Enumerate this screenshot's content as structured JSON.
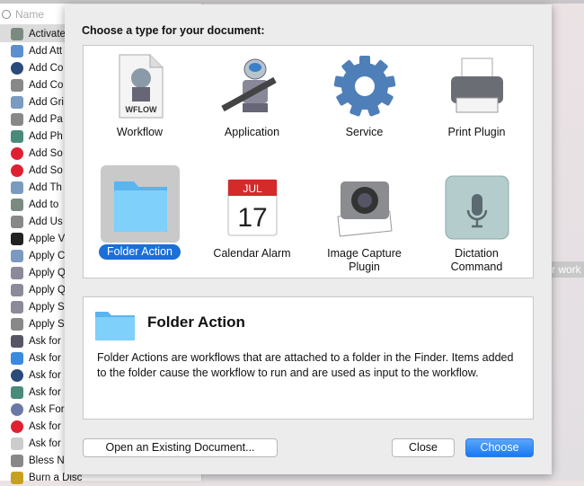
{
  "sidebar": {
    "search_placeholder": "Name",
    "items": [
      {
        "label": "Activate",
        "icon": "font-icon",
        "color": "#7a8a80"
      },
      {
        "label": "Add Att",
        "icon": "mail-icon",
        "color": "#5b8fd0"
      },
      {
        "label": "Add Co",
        "icon": "quicktime-icon",
        "color": "#2a4a7a"
      },
      {
        "label": "Add Co",
        "icon": "automator-icon",
        "color": "#888"
      },
      {
        "label": "Add Gri",
        "icon": "preview-icon",
        "color": "#7a9ac0"
      },
      {
        "label": "Add Pa",
        "icon": "automator-icon",
        "color": "#888"
      },
      {
        "label": "Add Ph",
        "icon": "image-capture-icon",
        "color": "#4a8a7a"
      },
      {
        "label": "Add So",
        "icon": "itunes-icon",
        "color": "#e02030"
      },
      {
        "label": "Add So",
        "icon": "itunes-icon",
        "color": "#e02030"
      },
      {
        "label": "Add Th",
        "icon": "preview-icon",
        "color": "#7a9ac0"
      },
      {
        "label": "Add to",
        "icon": "font-icon",
        "color": "#7a8a80"
      },
      {
        "label": "Add Us",
        "icon": "automator-icon",
        "color": "#888"
      },
      {
        "label": "Apple V",
        "icon": "terminal-icon",
        "color": "#222"
      },
      {
        "label": "Apply C",
        "icon": "preview-icon",
        "color": "#7a9ac0"
      },
      {
        "label": "Apply Q",
        "icon": "x-tools-icon",
        "color": "#8a8a9a"
      },
      {
        "label": "Apply Q",
        "icon": "x-tools-icon",
        "color": "#8a8a9a"
      },
      {
        "label": "Apply S",
        "icon": "x-tools-icon",
        "color": "#8a8a9a"
      },
      {
        "label": "Apply S",
        "icon": "automator-icon",
        "color": "#888"
      },
      {
        "label": "Ask for",
        "icon": "automator-robot-icon",
        "color": "#556"
      },
      {
        "label": "Ask for",
        "icon": "finder-icon",
        "color": "#3a8ae0"
      },
      {
        "label": "Ask for",
        "icon": "quicktime-icon",
        "color": "#2a4a7a"
      },
      {
        "label": "Ask for",
        "icon": "image-capture-icon",
        "color": "#4a8a7a"
      },
      {
        "label": "Ask For",
        "icon": "network-icon",
        "color": "#6a78a8"
      },
      {
        "label": "Ask for",
        "icon": "itunes-icon",
        "color": "#e02030"
      },
      {
        "label": "Ask for",
        "icon": "textedit-icon",
        "color": "#ccc"
      },
      {
        "label": "Bless N",
        "icon": "automator-icon",
        "color": "#888"
      },
      {
        "label": "Burn a Disc",
        "icon": "burn-icon",
        "color": "#c8a020"
      }
    ]
  },
  "background_hint": "r work",
  "dialog": {
    "prompt": "Choose a type for your document:",
    "types": [
      {
        "label": "Workflow",
        "icon": "workflow-document-icon",
        "sublabel": "WFLOW"
      },
      {
        "label": "Application",
        "icon": "automator-robot-icon"
      },
      {
        "label": "Service",
        "icon": "gear-icon"
      },
      {
        "label": "Print Plugin",
        "icon": "printer-icon"
      },
      {
        "label": "Folder Action",
        "icon": "folder-icon",
        "selected": true
      },
      {
        "label": "Calendar Alarm",
        "icon": "calendar-icon",
        "month": "JUL",
        "day": "17"
      },
      {
        "label": "Image Capture Plugin",
        "icon": "camera-icon"
      },
      {
        "label": "Dictation Command",
        "icon": "microphone-icon"
      }
    ],
    "description": {
      "title": "Folder Action",
      "text": "Folder Actions are workflows that are attached to a folder in the Finder. Items added to the folder cause the workflow to run and are used as input to the workflow."
    },
    "buttons": {
      "open": "Open an Existing Document...",
      "close": "Close",
      "choose": "Choose"
    }
  }
}
